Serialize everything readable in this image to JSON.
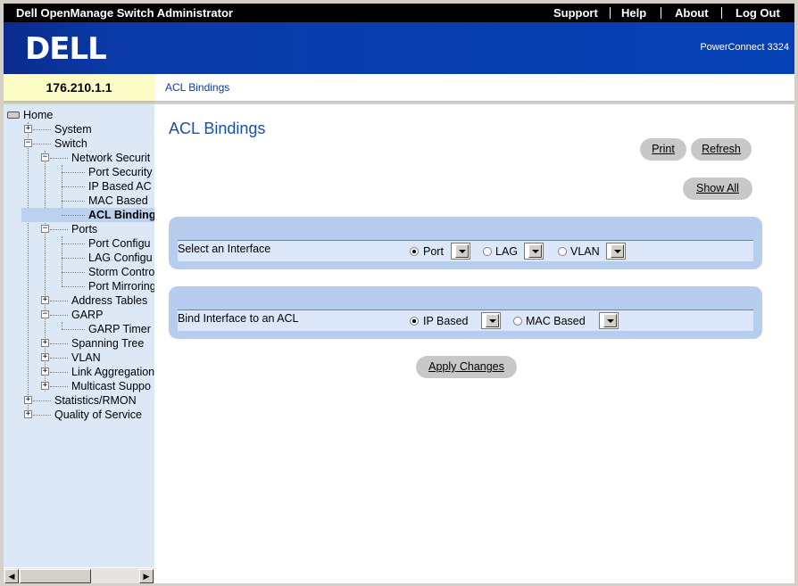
{
  "topbar": {
    "title": "Dell OpenManage Switch Administrator",
    "links": [
      "Support",
      "Help",
      "About",
      "Log Out"
    ]
  },
  "banner": {
    "logo": "DELL",
    "product": "PowerConnect 3324"
  },
  "ip_address": "176.210.1.1",
  "breadcrumb": "ACL Bindings",
  "tree": {
    "home": "Home",
    "system": "System",
    "switch": "Switch",
    "network_security": "Network Securit",
    "port_security": "Port Security",
    "ip_based_acl": "IP Based AC",
    "mac_based": "MAC Based",
    "acl_bindings": "ACL Binding",
    "ports": "Ports",
    "port_config": "Port Configu",
    "lag_config": "LAG Configu",
    "storm_control": "Storm Contro",
    "port_mirroring": "Port Mirroring",
    "address_tables": "Address Tables",
    "garp": "GARP",
    "garp_timer": "GARP Timer",
    "spanning_tree": "Spanning Tree",
    "vlan": "VLAN",
    "link_aggregation": "Link Aggregation",
    "multicast_support": "Multicast Suppo",
    "statistics_rmon": "Statistics/RMON",
    "quality_of_service": "Quality of Service"
  },
  "main": {
    "title": "ACL Bindings",
    "buttons": {
      "print": "Print",
      "refresh": "Refresh",
      "show_all": "Show All",
      "apply": "Apply Changes"
    },
    "select_interface": {
      "label": "Select an Interface",
      "options": [
        "Port",
        "LAG",
        "VLAN"
      ],
      "selected": "Port"
    },
    "bind_acl": {
      "label": "Bind Interface to an ACL",
      "options": [
        "IP Based",
        "MAC Based"
      ],
      "selected": "IP Based"
    }
  },
  "colors": {
    "title_blue": "#1a4fa6",
    "banner_blue": "#0541b5",
    "panel_blue": "#b7cdf0",
    "ip_bg": "#fcfcc6"
  }
}
